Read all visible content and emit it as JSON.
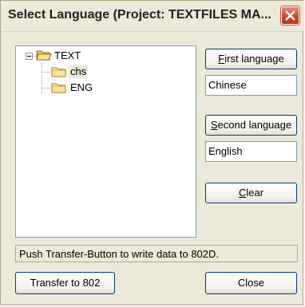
{
  "window": {
    "title": "Select Language (Project: TEXTFILES MA...",
    "close_icon": "close-icon"
  },
  "tree": {
    "root": {
      "label": "TEXT",
      "expanded": true,
      "icon": "folder-open-icon"
    },
    "children": [
      {
        "label": "chs",
        "selected": true,
        "icon": "folder-icon"
      },
      {
        "label": "ENG",
        "selected": false,
        "icon": "folder-icon"
      }
    ]
  },
  "buttons": {
    "first_language": {
      "mnemonic": "F",
      "rest": "irst language"
    },
    "second_language": {
      "mnemonic": "S",
      "rest": "econd language"
    },
    "clear": {
      "mnemonic": "C",
      "rest": "lear"
    },
    "transfer": "Transfer to 802",
    "close": "Close"
  },
  "fields": {
    "first_language_value": "Chinese",
    "second_language_value": "English"
  },
  "status_text": "Push Transfer-Button to write data to 802D.",
  "colors": {
    "dialog_bg": "#ece9d8",
    "button_border": "#003c74",
    "field_border": "#7f9db9",
    "close_button": "#c9432a"
  }
}
